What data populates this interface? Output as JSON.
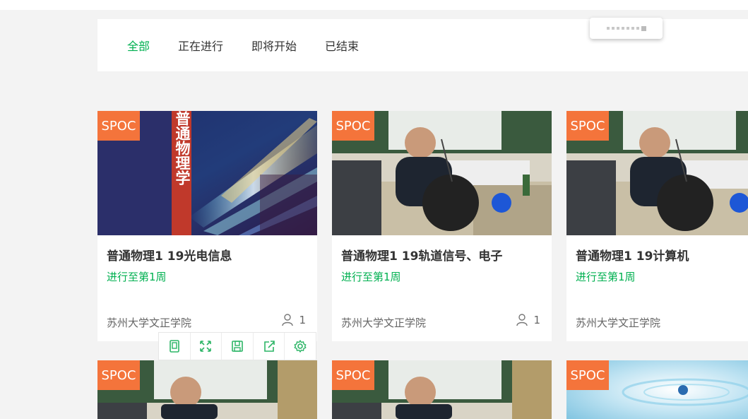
{
  "tabs": [
    {
      "label": "全部",
      "active": true
    },
    {
      "label": "正在进行",
      "active": false
    },
    {
      "label": "即将开始",
      "active": false
    },
    {
      "label": "已结束",
      "active": false
    }
  ],
  "colors": {
    "accent": "#00b050",
    "badge": "#f4743b"
  },
  "courses": [
    {
      "badge": "SPOC",
      "cover_text": "普通物理学",
      "title": "普通物理1 19光电信息",
      "status": "进行至第1周",
      "school": "苏州大学文正学院",
      "students": "1"
    },
    {
      "badge": "SPOC",
      "title": "普通物理1 19轨道信号、电子",
      "status": "进行至第1周",
      "school": "苏州大学文正学院",
      "students": "1"
    },
    {
      "badge": "SPOC",
      "title": "普通物理1 19计算机",
      "status": "进行至第1周",
      "school": "苏州大学文正学院"
    },
    {
      "badge": "SPOC"
    },
    {
      "badge": "SPOC"
    },
    {
      "badge": "SPOC"
    }
  ],
  "actions": [
    "tablet-icon",
    "expand-icon",
    "save-icon",
    "share-icon",
    "settings-icon"
  ]
}
